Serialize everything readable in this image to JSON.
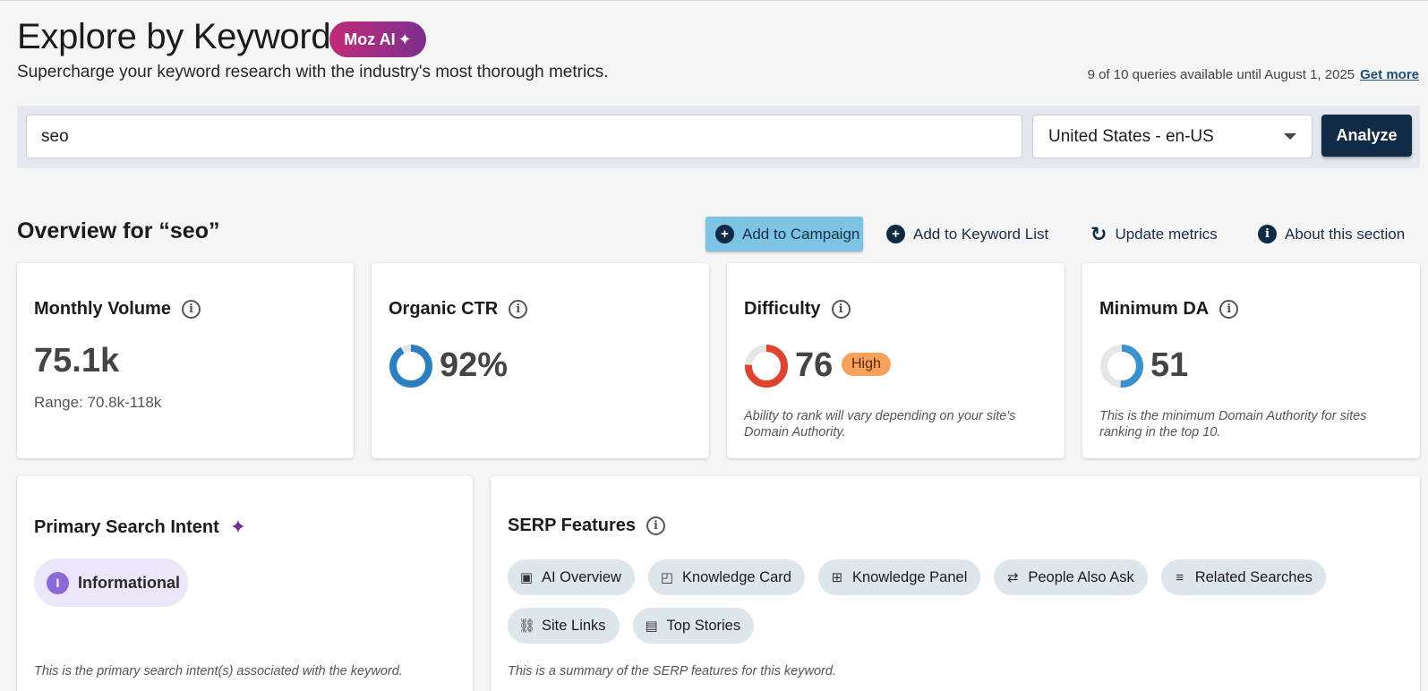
{
  "header": {
    "title": "Explore by Keyword",
    "badge": "Moz AI",
    "subtitle": "Supercharge your keyword research with the industry's most thorough metrics.",
    "quota_text": "9 of 10 queries available until August 1, 2025",
    "get_more": "Get more"
  },
  "search": {
    "keyword": "seo",
    "locale": "United States - en-US",
    "analyze_label": "Analyze"
  },
  "overview": {
    "title": "Overview for “seo”",
    "actions": {
      "add_campaign": "Add to Campaign",
      "add_list": "Add to Keyword List",
      "update": "Update metrics",
      "about": "About this section"
    }
  },
  "metrics": {
    "volume": {
      "title": "Monthly Volume",
      "value": "75.1k",
      "range": "Range: 70.8k-118k"
    },
    "ctr": {
      "title": "Organic CTR",
      "value": "92%",
      "fraction": 0.92,
      "color": "#2a7fc1"
    },
    "difficulty": {
      "title": "Difficulty",
      "value": "76",
      "fraction": 0.76,
      "badge": "High",
      "color": "#e1432f",
      "note": "Ability to rank will vary depending on your site's Domain Authority."
    },
    "min_da": {
      "title": "Minimum DA",
      "value": "51",
      "fraction": 0.51,
      "color": "#3a93d0",
      "note": "This is the minimum Domain Authority for sites ranking in the top 10."
    }
  },
  "intent": {
    "title": "Primary Search Intent",
    "pill": "Informational",
    "pill_letter": "I",
    "note": "This is the primary search intent(s) associated with the keyword."
  },
  "serp": {
    "title": "SERP Features",
    "features": [
      {
        "label": "AI Overview",
        "icon": "ai-overview-icon"
      },
      {
        "label": "Knowledge Card",
        "icon": "knowledge-card-icon"
      },
      {
        "label": "Knowledge Panel",
        "icon": "knowledge-panel-icon"
      },
      {
        "label": "People Also Ask",
        "icon": "swap-arrows-icon"
      },
      {
        "label": "Related Searches",
        "icon": "related-search-icon"
      },
      {
        "label": "Site Links",
        "icon": "link-icon"
      },
      {
        "label": "Top Stories",
        "icon": "newspaper-icon"
      }
    ],
    "note": "This is a summary of the SERP features for this keyword."
  }
}
